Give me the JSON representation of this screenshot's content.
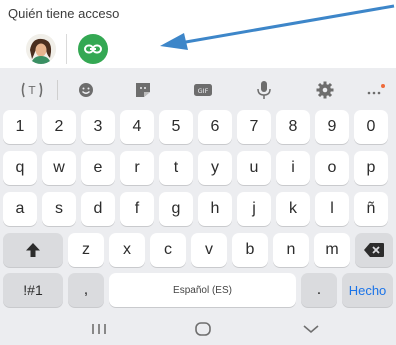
{
  "header": {
    "title": "Quién tiene acceso"
  },
  "keyboard": {
    "number_row": [
      "1",
      "2",
      "3",
      "4",
      "5",
      "6",
      "7",
      "8",
      "9",
      "0"
    ],
    "row1": [
      "q",
      "w",
      "e",
      "r",
      "t",
      "y",
      "u",
      "i",
      "o",
      "p"
    ],
    "row2": [
      "a",
      "s",
      "d",
      "f",
      "g",
      "h",
      "j",
      "k",
      "l",
      "ñ"
    ],
    "row3": [
      "z",
      "x",
      "c",
      "v",
      "b",
      "n",
      "m"
    ],
    "symbols_label": "!#1",
    "comma_label": ",",
    "space_label": "Español (ES)",
    "period_label": ".",
    "enter_label": "Hecho",
    "toolbar_icons": [
      "text-translate-icon",
      "emoji-icon",
      "sticker-icon",
      "gif-icon",
      "microphone-icon",
      "settings-icon",
      "more-icon"
    ]
  },
  "colors": {
    "accent": "#1a73e8",
    "link_button": "#34a853",
    "arrow": "#3d86c9",
    "keyboard_bg": "#ecedf0"
  }
}
